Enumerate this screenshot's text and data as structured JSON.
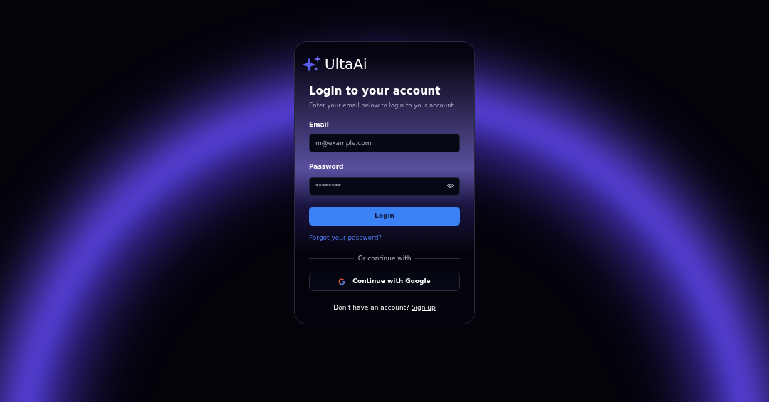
{
  "brand": {
    "name": "UltaAi"
  },
  "title": "Login to your account",
  "subtitle": "Enter your email below to login to your account",
  "fields": [
    {
      "kind": "email",
      "label": "Email",
      "placeholder": "m@example.com"
    },
    {
      "kind": "password",
      "label": "Password",
      "value": "********"
    }
  ],
  "login_button": "Login",
  "forgot_link": "Forgot your password?",
  "divider_text": "Or continue with",
  "google_button": "Continue with Google",
  "signup": {
    "prompt": "Don't have an account?",
    "link": "Sign up"
  }
}
